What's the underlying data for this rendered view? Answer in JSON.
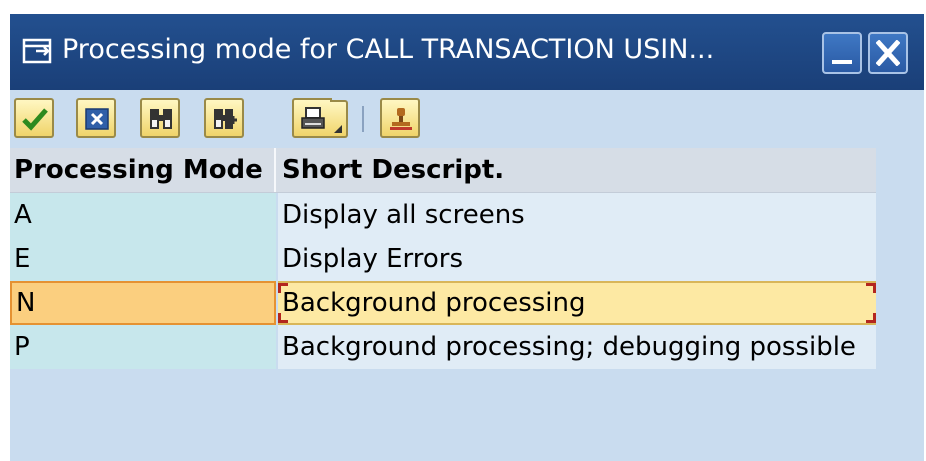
{
  "window": {
    "title": "Processing mode for CALL TRANSACTION USIN..."
  },
  "toolbar": {
    "buttons": [
      {
        "name": "checkmark-icon"
      },
      {
        "name": "cancel-icon"
      },
      {
        "name": "find-icon"
      },
      {
        "name": "find-next-icon"
      },
      {
        "name": "print-icon"
      },
      {
        "name": "stamp-icon"
      }
    ]
  },
  "table": {
    "headers": [
      "Processing Mode",
      "Short Descript."
    ],
    "rows": [
      {
        "mode": "A",
        "description": "Display all screens"
      },
      {
        "mode": "E",
        "description": "Display Errors"
      },
      {
        "mode": "N",
        "description": "Background processing"
      },
      {
        "mode": "P",
        "description": "Background processing; debugging possible"
      }
    ],
    "selected_index": 2
  },
  "colors": {
    "titlebar": "#1a3f78",
    "header_bg": "#d6dde6",
    "key_col_bg": "#c7e7ec",
    "selected_bg": "#fde9a3"
  }
}
